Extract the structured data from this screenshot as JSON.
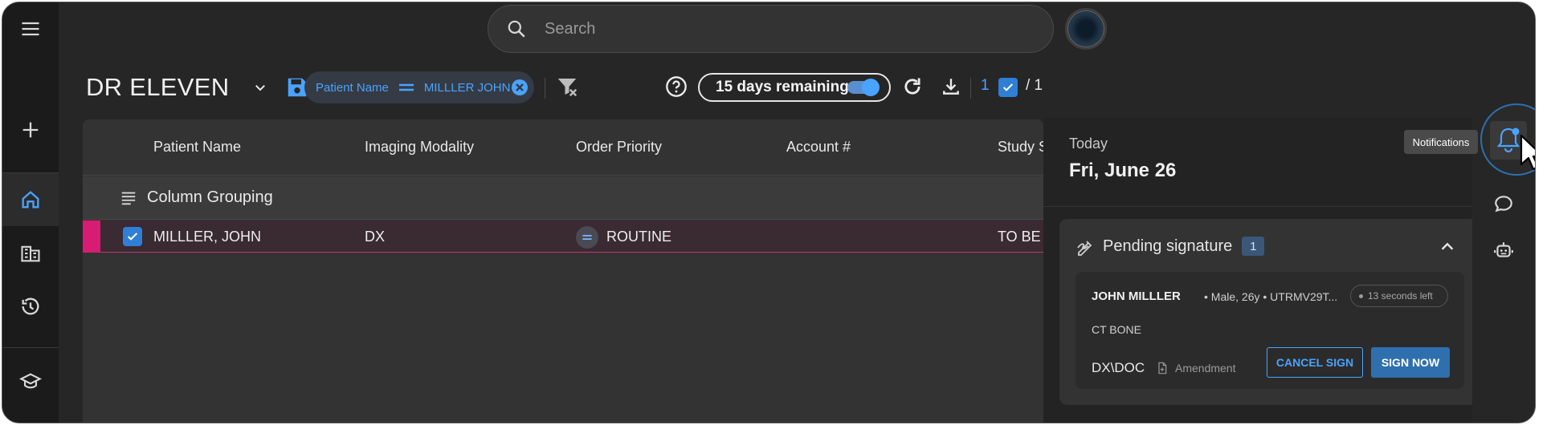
{
  "search": {
    "placeholder": "Search"
  },
  "toolbar": {
    "title": "DR ELEVEN",
    "filter_chip": {
      "field": "Patient Name",
      "value": "MILLLER JOHN"
    },
    "remaining_label": "15 days remaining",
    "selected_count": "1",
    "selected_total": "/ 1"
  },
  "grid": {
    "columns": [
      "Patient Name",
      "Imaging Modality",
      "Order Priority",
      "Account #",
      "Study S"
    ],
    "group_label": "Column Grouping",
    "rows": [
      {
        "patient_name": "MILLLER, JOHN",
        "modality": "DX",
        "priority": "ROUTINE",
        "account": "",
        "study_status": "TO BE A"
      }
    ]
  },
  "notifications": {
    "tooltip": "Notifications",
    "day_label": "Today",
    "date": "Fri, June 26",
    "pending": {
      "title": "Pending signature",
      "count": "1",
      "item": {
        "patient": "JOHN MILLLER",
        "meta": "•  Male, 26y  •  UTRMV29T...",
        "time_left": "13 seconds left",
        "study": "CT BONE",
        "modality": "DX\\DOC",
        "amendment": "Amendment",
        "cancel_label": "CANCEL SIGN",
        "sign_label": "SIGN NOW"
      }
    }
  },
  "colors": {
    "accent": "#4aa3ff",
    "row_highlight": "#d81b73",
    "sign_button": "#2f6fae"
  }
}
